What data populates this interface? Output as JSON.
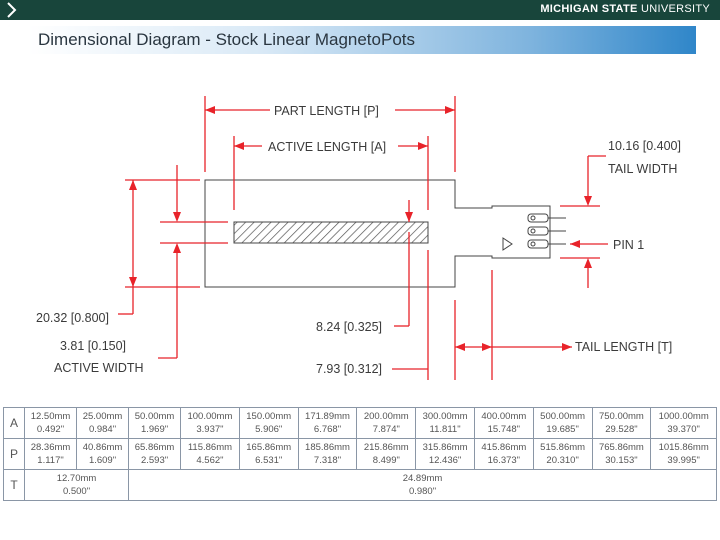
{
  "header": {
    "brand_bold": "MICHIGAN STATE",
    "brand_light": " UNIVERSITY",
    "bar_color": "#18453b"
  },
  "slide": {
    "title": "Dimensional Diagram - Stock Linear MagnetoPots"
  },
  "diagram": {
    "labels": {
      "part_length": "PART LENGTH [P]",
      "active_length": "ACTIVE LENGTH [A]",
      "tail_width_value": "10.16 [0.400]",
      "tail_width": "TAIL WIDTH",
      "pin1": "PIN 1",
      "overall_width": "20.32 [0.800]",
      "active_width_value": "3.81 [0.150]",
      "active_width": "ACTIVE WIDTH",
      "dim_824": "8.24 [0.325]",
      "dim_793": "7.93 [0.312]",
      "tail_length": "TAIL LENGTH [T]"
    },
    "line_color": "#e8232a"
  },
  "table": {
    "rows": [
      {
        "label": "A",
        "cells": [
          [
            "12.50mm",
            "0.492\""
          ],
          [
            "25.00mm",
            "0.984\""
          ],
          [
            "50.00mm",
            "1.969\""
          ],
          [
            "100.00mm",
            "3.937\""
          ],
          [
            "150.00mm",
            "5.906\""
          ],
          [
            "171.89mm",
            "6.768\""
          ],
          [
            "200.00mm",
            "7.874\""
          ],
          [
            "300.00mm",
            "11.811\""
          ],
          [
            "400.00mm",
            "15.748\""
          ],
          [
            "500.00mm",
            "19.685\""
          ],
          [
            "750.00mm",
            "29.528\""
          ],
          [
            "1000.00mm",
            "39.370\""
          ]
        ]
      },
      {
        "label": "P",
        "cells": [
          [
            "28.36mm",
            "1.117\""
          ],
          [
            "40.86mm",
            "1.609\""
          ],
          [
            "65.86mm",
            "2.593\""
          ],
          [
            "115.86mm",
            "4.562\""
          ],
          [
            "165.86mm",
            "6.531\""
          ],
          [
            "185.86mm",
            "7.318\""
          ],
          [
            "215.86mm",
            "8.499\""
          ],
          [
            "315.86mm",
            "12.436\""
          ],
          [
            "415.86mm",
            "16.373\""
          ],
          [
            "515.86mm",
            "20.310\""
          ],
          [
            "765.86mm",
            "30.153\""
          ],
          [
            "1015.86mm",
            "39.995\""
          ]
        ]
      },
      {
        "label": "T",
        "first": [
          "12.70mm",
          "0.500\""
        ],
        "rest": [
          "24.89mm",
          "0.980\""
        ]
      }
    ]
  }
}
